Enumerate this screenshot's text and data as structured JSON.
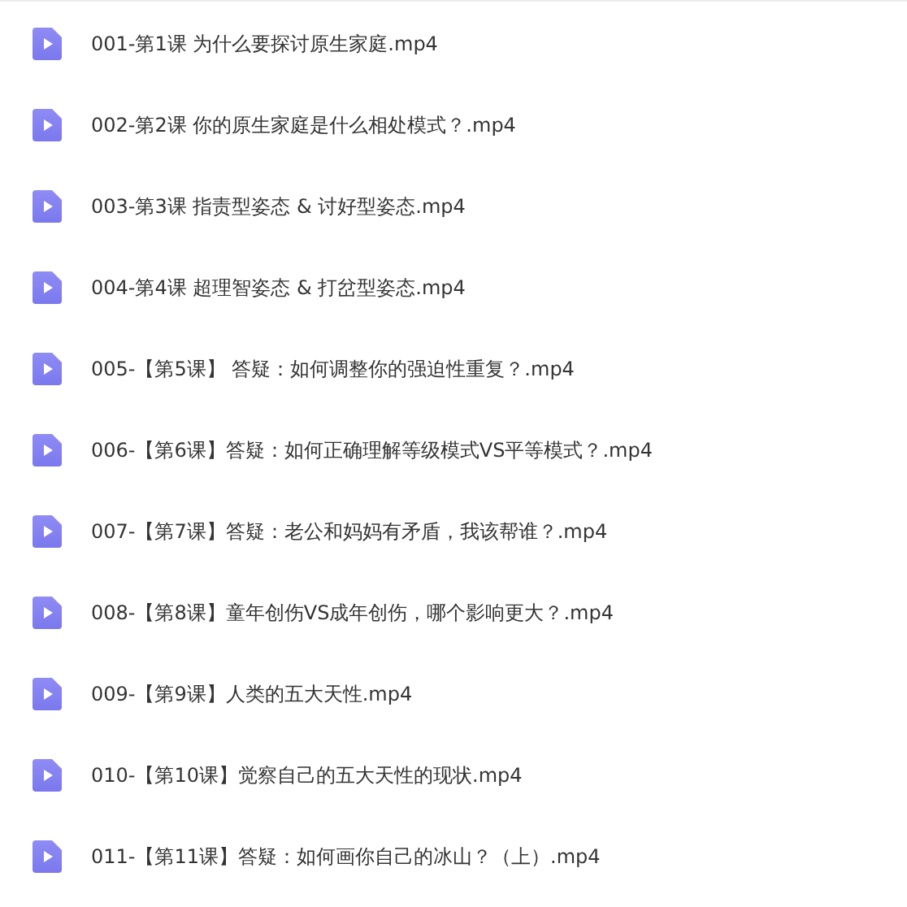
{
  "files": [
    {
      "name": "001-第1课 为什么要探讨原生家庭.mp4"
    },
    {
      "name": "002-第2课 你的原生家庭是什么相处模式？.mp4"
    },
    {
      "name": "003-第3课 指责型姿态 & 讨好型姿态.mp4"
    },
    {
      "name": "004-第4课 超理智姿态 & 打岔型姿态.mp4"
    },
    {
      "name": "005-【第5课】 答疑：如何调整你的强迫性重复？.mp4"
    },
    {
      "name": "006-【第6课】答疑：如何正确理解等级模式VS平等模式？.mp4"
    },
    {
      "name": "007-【第7课】答疑：老公和妈妈有矛盾，我该帮谁？.mp4"
    },
    {
      "name": "008-【第8课】童年创伤VS成年创伤，哪个影响更大？.mp4"
    },
    {
      "name": "009-【第9课】人类的五大天性.mp4"
    },
    {
      "name": "010-【第10课】觉察自己的五大天性的现状.mp4"
    },
    {
      "name": "011-【第11课】答疑：如何画你自己的冰山？（上）.mp4"
    }
  ]
}
